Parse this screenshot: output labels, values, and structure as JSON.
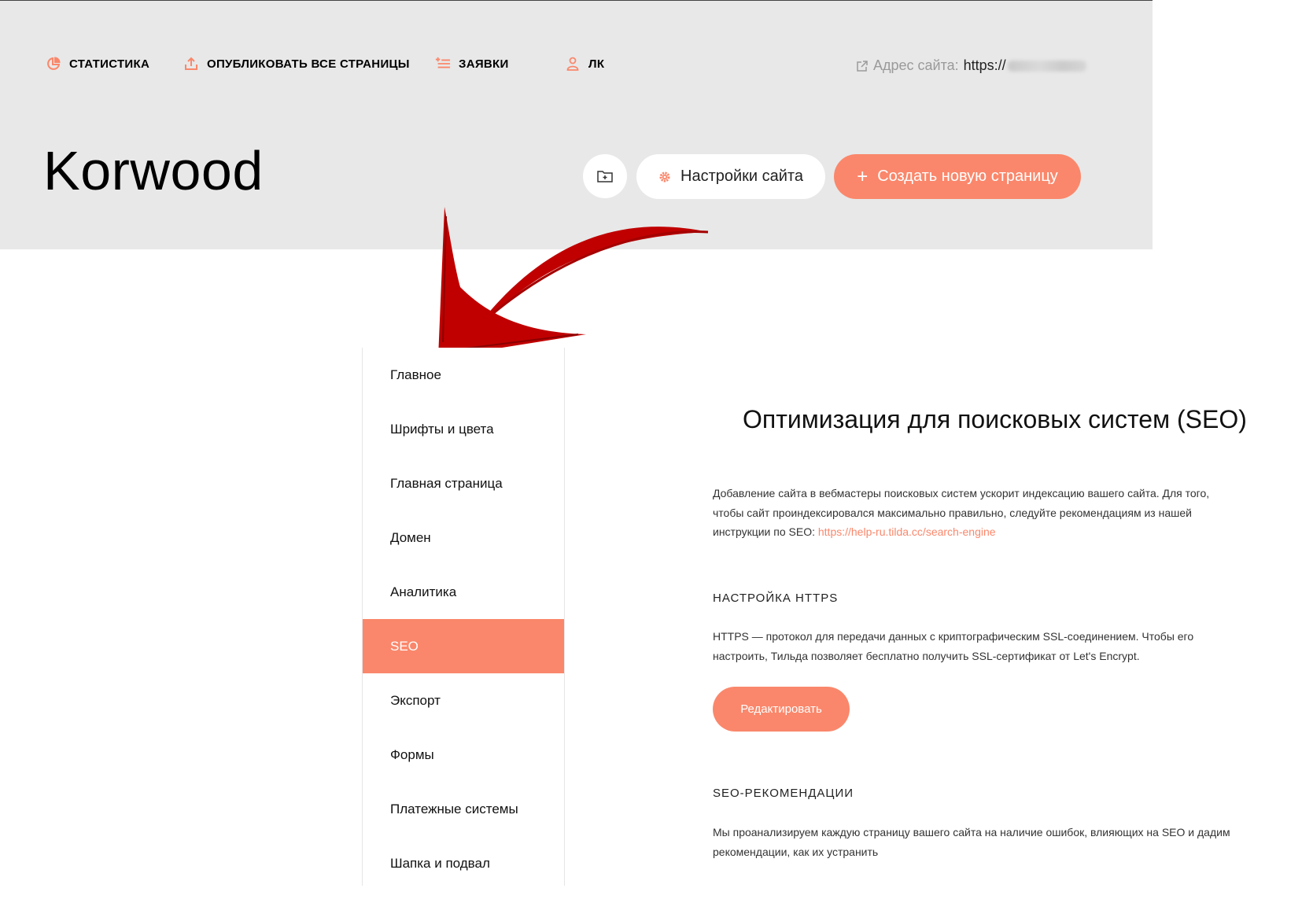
{
  "topnav": {
    "stats": "СТАТИСТИКА",
    "publish": "ОПУБЛИКОВАТЬ ВСЕ СТРАНИЦЫ",
    "leads": "ЗАЯВКИ",
    "account": "ЛК"
  },
  "address": {
    "label": "Адрес сайта:",
    "url_prefix": "https://"
  },
  "site": {
    "title": "Korwood",
    "settings_label": "Настройки сайта",
    "create_label": "Создать новую страницу"
  },
  "sidebar": {
    "items": [
      {
        "label": "Главное"
      },
      {
        "label": "Шрифты и цвета"
      },
      {
        "label": "Главная страница"
      },
      {
        "label": "Домен"
      },
      {
        "label": "Аналитика"
      },
      {
        "label": "SEO"
      },
      {
        "label": "Экспорт"
      },
      {
        "label": "Формы"
      },
      {
        "label": "Платежные системы"
      },
      {
        "label": "Шапка и подвал"
      }
    ],
    "active": "SEO"
  },
  "content": {
    "title": "Оптимизация для поисковых систем (SEO)",
    "intro": "Добавление сайта в вебмастеры поисковых систем ускорит индексацию вашего сайта. Для того, чтобы сайт проиндексировался максимально правильно, следуйте рекомендациям из нашей инструкции по SEO:",
    "intro_link": "https://help-ru.tilda.cc/search-engine",
    "https_heading": "НАСТРОЙКА HTTPS",
    "https_text": "HTTPS — протокол для передачи данных с криптографическим SSL-соединением. Чтобы его настроить, Тильда позволяет бесплатно получить SSL-сертификат от Let's Encrypt.",
    "edit_label": "Редактировать",
    "seo_heading": "SEO-РЕКОМЕНДАЦИИ",
    "seo_text": "Мы проанализируем каждую страницу вашего сайта на наличие ошибок, влияющих на SEO и дадим рекомендации, как их устранить"
  },
  "colors": {
    "accent": "#fa876b",
    "header_bg": "#e8e8e8",
    "arrow": "#c00000"
  }
}
